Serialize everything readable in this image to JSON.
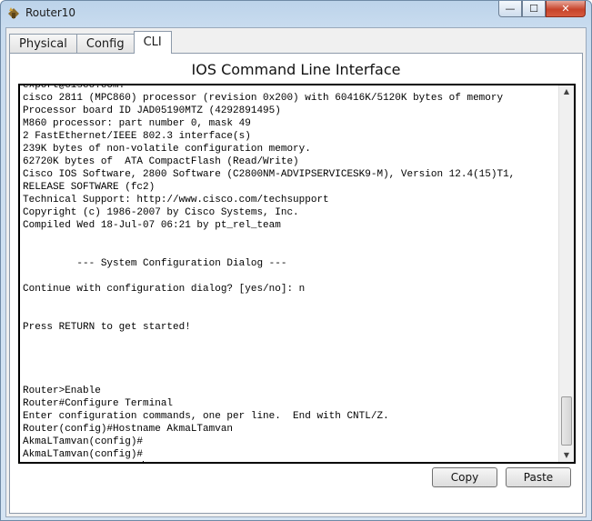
{
  "window": {
    "title": "Router10",
    "icon": "router-icon"
  },
  "tabs": [
    {
      "label": "Physical"
    },
    {
      "label": "Config"
    },
    {
      "label": "CLI"
    }
  ],
  "active_tab": "CLI",
  "cli": {
    "heading": "IOS Command Line Interface",
    "lines": [
      "export@cisco.com.",
      "cisco 2811 (MPC860) processor (revision 0x200) with 60416K/5120K bytes of memory",
      "Processor board ID JAD05190MTZ (4292891495)",
      "M860 processor: part number 0, mask 49",
      "2 FastEthernet/IEEE 802.3 interface(s)",
      "239K bytes of non-volatile configuration memory.",
      "62720K bytes of  ATA CompactFlash (Read/Write)",
      "Cisco IOS Software, 2800 Software (C2800NM-ADVIPSERVICESK9-M), Version 12.4(15)T1,",
      "RELEASE SOFTWARE (fc2)",
      "Technical Support: http://www.cisco.com/techsupport",
      "Copyright (c) 1986-2007 by Cisco Systems, Inc.",
      "Compiled Wed 18-Jul-07 06:21 by pt_rel_team",
      "",
      "",
      "         --- System Configuration Dialog ---",
      "",
      "Continue with configuration dialog? [yes/no]: n",
      "",
      "",
      "Press RETURN to get started!",
      "",
      "",
      "",
      "",
      "Router>Enable",
      "Router#Configure Terminal",
      "Enter configuration commands, one per line.  End with CNTL/Z.",
      "Router(config)#Hostname AkmaLTamvan",
      "AkmaLTamvan(config)#",
      "AkmaLTamvan(config)#",
      "AkmaLTamvan(config)#"
    ]
  },
  "buttons": {
    "copy": "Copy",
    "paste": "Paste"
  },
  "window_controls": {
    "minimize": "—",
    "maximize": "☐",
    "close": "✕"
  }
}
